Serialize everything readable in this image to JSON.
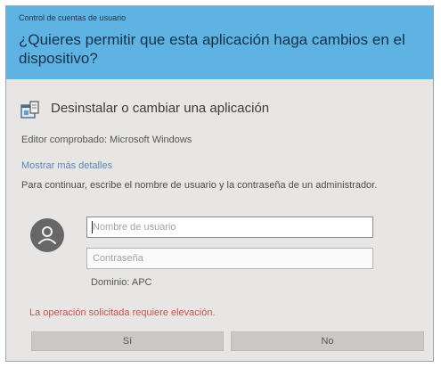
{
  "dialog": {
    "window_title": "Control de cuentas de usuario",
    "question": "¿Quieres permitir que esta aplicación haga cambios en el dispositivo?",
    "app": {
      "icon": "uninstall-programs-icon",
      "name": "Desinstalar o cambiar una aplicación"
    },
    "publisher_line": "Editor comprobado: Microsoft Windows",
    "details_link": "Mostrar más detalles",
    "instructions": "Para continuar, escribe el nombre de usuario y la contraseña de un administrador.",
    "avatar_icon": "user-icon",
    "username_placeholder": "Nombre de usuario",
    "password_placeholder": "Contraseña",
    "domain_line": "Dominio: APC",
    "error_message": "La operación solicitada requiere elevación.",
    "buttons": {
      "yes": "Sí",
      "no": "No"
    }
  },
  "colors": {
    "header": "#5fb3e2",
    "body": "#e7e6e4",
    "link": "#5a86b8",
    "error": "#c0564e",
    "button": "#cac9c7"
  }
}
